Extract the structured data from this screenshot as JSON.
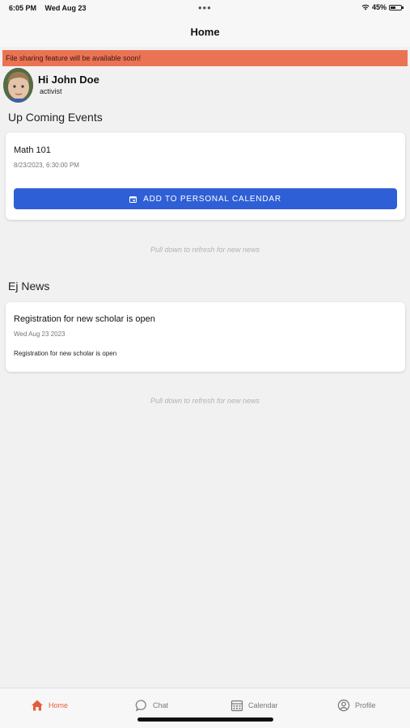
{
  "status_bar": {
    "time": "6:05 PM",
    "date": "Wed Aug 23",
    "dots": "•••",
    "battery": "45%"
  },
  "nav": {
    "title": "Home"
  },
  "banner": {
    "text": "File sharing feature will be available soon!"
  },
  "user": {
    "greeting": "Hi John Doe",
    "role": "activist"
  },
  "events": {
    "section_title": "Up Coming Events",
    "items": [
      {
        "title": "Math 101",
        "datetime": "8/23/2023, 6:30:00 PM",
        "button_label": "ADD TO PERSONAL CALENDAR"
      }
    ],
    "pull_hint": "Pull down to refresh for new news"
  },
  "news": {
    "section_title": "Ej News",
    "items": [
      {
        "title": "Registration for new scholar is open",
        "date": "Wed Aug 23 2023",
        "body": "Registration for new scholar is open"
      }
    ],
    "pull_hint": "Pull down to refresh for new news"
  },
  "tabs": [
    {
      "label": "Home",
      "icon": "home-icon",
      "active": true
    },
    {
      "label": "Chat",
      "icon": "chat-icon",
      "active": false
    },
    {
      "label": "Calendar",
      "icon": "calendar-icon",
      "active": false
    },
    {
      "label": "Profile",
      "icon": "profile-icon",
      "active": false
    }
  ],
  "colors": {
    "accent": "#e25d3c",
    "banner": "#ea7354",
    "button": "#2f5fd6"
  }
}
